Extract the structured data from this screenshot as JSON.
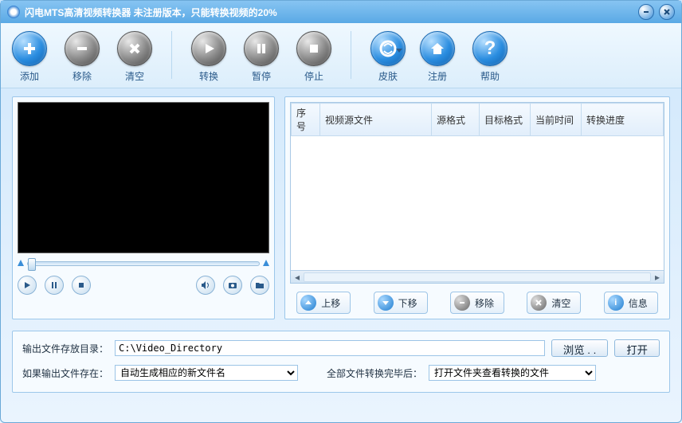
{
  "window": {
    "title": "闪电MTS高清视频转换器   未注册版本，只能转换视频的20%"
  },
  "toolbar": {
    "add": "添加",
    "remove": "移除",
    "clear": "清空",
    "convert": "转换",
    "pause": "暂停",
    "stop": "停止",
    "skin": "皮肤",
    "register": "注册",
    "help": "帮助"
  },
  "table": {
    "columns": [
      "序号",
      "视频源文件",
      "源格式",
      "目标格式",
      "当前时间",
      "转换进度"
    ],
    "rows": []
  },
  "list_buttons": {
    "up": "上移",
    "down": "下移",
    "remove": "移除",
    "clear": "清空",
    "info": "信息"
  },
  "bottom": {
    "output_dir_label": "输出文件存放目录：",
    "output_dir_value": "C:\\Video_Directory",
    "browse": "浏览 . .",
    "open": "打开",
    "if_exists_label": "如果输出文件存在：",
    "if_exists_options": [
      "自动生成相应的新文件名"
    ],
    "if_exists_selected": "自动生成相应的新文件名",
    "after_all_label": "全部文件转换完毕后：",
    "after_all_options": [
      "打开文件夹查看转换的文件"
    ],
    "after_all_selected": "打开文件夹查看转换的文件"
  }
}
